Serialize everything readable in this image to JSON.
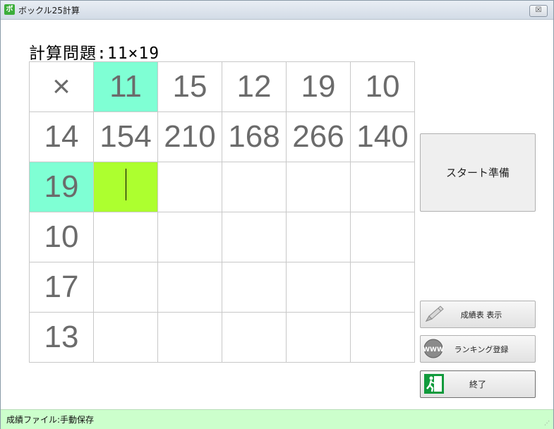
{
  "window": {
    "title": "ボックル25計算",
    "close_label": "☒"
  },
  "problem": {
    "label": "計算問題:11×19"
  },
  "grid": {
    "corner": "×",
    "columns": [
      "11",
      "15",
      "12",
      "19",
      "10"
    ],
    "rows": [
      {
        "header": "14",
        "values": [
          "154",
          "210",
          "168",
          "266",
          "140"
        ]
      },
      {
        "header": "19",
        "values": [
          "",
          "",
          "",
          "",
          ""
        ]
      },
      {
        "header": "10",
        "values": [
          "",
          "",
          "",
          "",
          ""
        ]
      },
      {
        "header": "17",
        "values": [
          "",
          "",
          "",
          "",
          ""
        ]
      },
      {
        "header": "13",
        "values": [
          "",
          "",
          "",
          "",
          ""
        ]
      }
    ],
    "highlight_color": "#7fffd4",
    "active_color": "#adff2f"
  },
  "buttons": {
    "start": "スタート準備",
    "scores": "成績表 表示",
    "ranking": "ランキング登録",
    "exit": "終了"
  },
  "statusbar": {
    "text": "成績ファイル:手動保存",
    "background": "#ccffcc"
  }
}
